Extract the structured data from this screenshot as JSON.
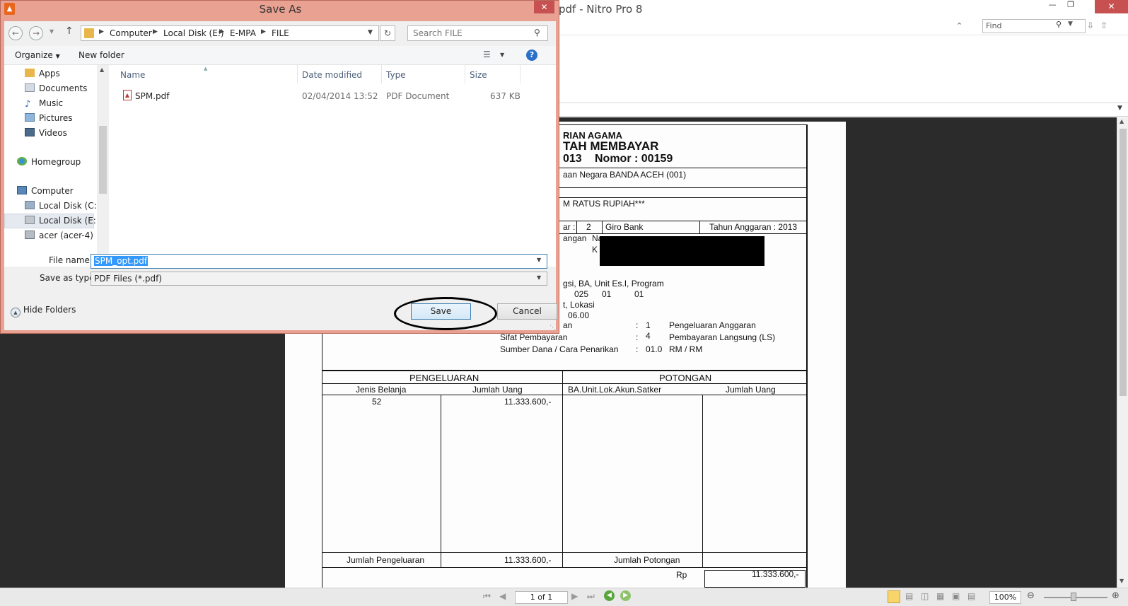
{
  "nitro": {
    "title": "pdf - Nitro Pro 8",
    "find_placeholder": "Find",
    "status": {
      "page_indicator": "1 of 1",
      "zoom": "100%"
    }
  },
  "pdf": {
    "header1": "RIAN AGAMA",
    "header2": "TAH MEMBAYAR",
    "header3_a": "013",
    "header3_b": "Nomor : 00159",
    "line_kppn": "aan Negara BANDA ACEH (001)",
    "line_rupiah": "M RATUS RUPIAH***",
    "line_ar": "ar :",
    "line_num": "2",
    "line_giro": "Giro Bank",
    "line_tahun": "Tahun Anggaran : 2013",
    "line_angan": "angan",
    "line_na": "Na",
    "line_k": "K",
    "line_fungsi": "gsi, BA, Unit Es.I, Program",
    "line_codes": [
      "025",
      "01",
      "01"
    ],
    "line_lokasi": "t, Lokasi",
    "line_0600": "06.00",
    "line_an": "an",
    "jenis_colon": ":",
    "jenis_val": "1",
    "jenis_text": "Pengeluaran Anggaran",
    "sifat_label": "Sifat Pembayaran",
    "sifat_colon": ":",
    "sifat_val": "4",
    "sifat_text": "Pembayaran Langsung (LS)",
    "sumber_label": "Sumber Dana / Cara Penarikan",
    "sumber_colon": ":",
    "sumber_val": "01.0",
    "sumber_text": "RM / RM",
    "table": {
      "pengeluaran": "PENGELUARAN",
      "potongan": "POTONGAN",
      "jenis_belanja": "Jenis Belanja",
      "jumlah_uang": "Jumlah Uang",
      "ba_unit": "BA.Unit.Lok.Akun.Satker",
      "jumlah_uang2": "Jumlah Uang",
      "row_code": "52",
      "row_amount": "11.333.600,-",
      "total_label": "Jumlah Pengeluaran",
      "total_amount": "11.333.600,-",
      "total_potongan": "Jumlah Potongan",
      "rp": "Rp",
      "rp_amount": "11.333.600,-"
    }
  },
  "dialog": {
    "title": "Save As",
    "breadcrumb": [
      "Computer",
      "Local Disk (E:)",
      "E-MPA",
      "FILE"
    ],
    "search_placeholder": "Search FILE",
    "toolbar": {
      "organize": "Organize",
      "new_folder": "New folder"
    },
    "nav_items": [
      {
        "label": "Apps",
        "icon": "folder-icon"
      },
      {
        "label": "Documents",
        "icon": "documents-icon"
      },
      {
        "label": "Music",
        "icon": "music-icon"
      },
      {
        "label": "Pictures",
        "icon": "pictures-icon"
      },
      {
        "label": "Videos",
        "icon": "videos-icon"
      },
      {
        "label": "Homegroup",
        "icon": "homegroup-icon"
      },
      {
        "label": "Computer",
        "icon": "computer-icon"
      },
      {
        "label": "Local Disk (C:)",
        "icon": "drive-icon"
      },
      {
        "label": "Local Disk (E:)",
        "icon": "drive-icon"
      },
      {
        "label": "acer (acer-4)",
        "icon": "network-drive-icon"
      }
    ],
    "columns": {
      "name": "Name",
      "date": "Date modified",
      "type": "Type",
      "size": "Size"
    },
    "files": [
      {
        "name": "SPM.pdf",
        "date": "02/04/2014 13:52",
        "type": "PDF Document",
        "size": "637 KB"
      }
    ],
    "file_name_label": "File name:",
    "file_name_value": "SPM_opt.pdf",
    "save_type_label": "Save as type:",
    "save_type_value": "PDF Files (*.pdf)",
    "hide_folders": "Hide Folders",
    "save": "Save",
    "cancel": "Cancel"
  },
  "colors": {
    "dialog_frame": "#e9a191",
    "close_red": "#c75050",
    "selection_blue": "#3399ff"
  }
}
